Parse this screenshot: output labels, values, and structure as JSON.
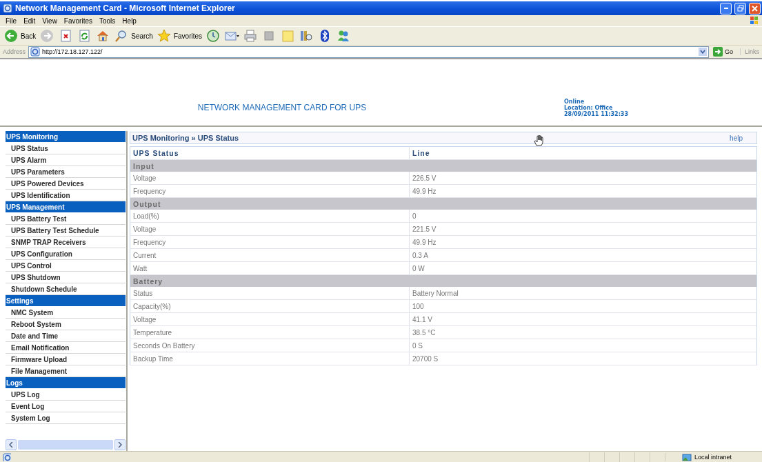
{
  "window": {
    "title": "Network Management Card - Microsoft Internet Explorer"
  },
  "menu": [
    "File",
    "Edit",
    "View",
    "Favorites",
    "Tools",
    "Help"
  ],
  "toolbar": [
    {
      "kind": "back",
      "label": "Back"
    },
    {
      "kind": "forward"
    },
    {
      "kind": "stop"
    },
    {
      "kind": "refresh"
    },
    {
      "kind": "home"
    },
    {
      "kind": "search",
      "label": "Search"
    },
    {
      "kind": "favorites",
      "label": "Favorites"
    },
    {
      "kind": "history"
    },
    {
      "kind": "mail"
    },
    {
      "kind": "print"
    },
    {
      "kind": "edit"
    },
    {
      "kind": "note"
    },
    {
      "kind": "research"
    },
    {
      "kind": "bluetooth"
    },
    {
      "kind": "messenger"
    }
  ],
  "address": {
    "label": "Address",
    "value": "http://172.18.127.122/",
    "go": "Go",
    "links": "Links"
  },
  "header": {
    "title": "NETWORK MANAGEMENT CARD FOR UPS",
    "status": "Online",
    "location": "Location: Office",
    "datetime": "28/09/2011 11:32:33"
  },
  "sidebar": {
    "groups": [
      {
        "title": "UPS Monitoring",
        "items": [
          "UPS Status",
          "UPS Alarm",
          "UPS Parameters",
          "UPS Powered Devices",
          "UPS Identification"
        ]
      },
      {
        "title": "UPS Management",
        "items": [
          "UPS Battery Test",
          "UPS Battery Test Schedule",
          "SNMP TRAP Receivers",
          "UPS Configuration",
          "UPS Control",
          "UPS Shutdown",
          "Shutdown Schedule"
        ]
      },
      {
        "title": "Settings",
        "items": [
          "NMC System",
          "Reboot System",
          "Date and Time",
          "Email Notification",
          "Firmware Upload",
          "File Management"
        ]
      },
      {
        "title": "Logs",
        "items": [
          "UPS Log",
          "Event Log",
          "System Log"
        ]
      }
    ]
  },
  "breadcrumb": {
    "parent": "UPS Monitoring",
    "separator": "»",
    "current": "UPS Status",
    "help": "help"
  },
  "table": {
    "columns": [
      "UPS Status",
      "Line"
    ],
    "sections": [
      {
        "title": "Input",
        "rows": [
          {
            "label": "Voltage",
            "value": "226.5 V"
          },
          {
            "label": "Frequency",
            "value": "49.9 Hz"
          }
        ]
      },
      {
        "title": "Output",
        "rows": [
          {
            "label": "Load(%)",
            "value": "0"
          },
          {
            "label": "Voltage",
            "value": "221.5 V"
          },
          {
            "label": "Frequency",
            "value": "49.9 Hz"
          },
          {
            "label": "Current",
            "value": "0.3 A"
          },
          {
            "label": "Watt",
            "value": "0 W"
          }
        ]
      },
      {
        "title": "Battery",
        "rows": [
          {
            "label": "Status",
            "value": "Battery Normal"
          },
          {
            "label": "Capacity(%)",
            "value": "100"
          },
          {
            "label": "Voltage",
            "value": "41.1 V"
          },
          {
            "label": "Temperature",
            "value": "38.5 °C"
          },
          {
            "label": "Seconds On Battery",
            "value": "0 S"
          },
          {
            "label": "Backup Time",
            "value": "20700 S"
          }
        ]
      }
    ]
  },
  "status_bar": {
    "zone": "Local intranet"
  }
}
